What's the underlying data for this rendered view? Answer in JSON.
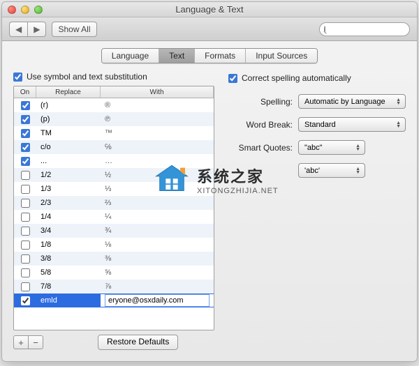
{
  "window_title": "Language & Text",
  "toolbar": {
    "show_all": "Show All",
    "search_placeholder": ""
  },
  "tabs": [
    "Language",
    "Text",
    "Formats",
    "Input Sources"
  ],
  "active_tab": "Text",
  "left": {
    "checkbox_label": "Use symbol and text substitution",
    "checkbox_checked": true,
    "headers": {
      "on": "On",
      "replace": "Replace",
      "with": "With"
    },
    "rows": [
      {
        "on": true,
        "replace": "(r)",
        "with": "®"
      },
      {
        "on": true,
        "replace": "(p)",
        "with": "℗"
      },
      {
        "on": true,
        "replace": "TM",
        "with": "™"
      },
      {
        "on": true,
        "replace": "c/o",
        "with": "℅"
      },
      {
        "on": true,
        "replace": "...",
        "with": "…"
      },
      {
        "on": false,
        "replace": "1/2",
        "with": "½"
      },
      {
        "on": false,
        "replace": "1/3",
        "with": "⅓"
      },
      {
        "on": false,
        "replace": "2/3",
        "with": "⅔"
      },
      {
        "on": false,
        "replace": "1/4",
        "with": "¼"
      },
      {
        "on": false,
        "replace": "3/4",
        "with": "¾"
      },
      {
        "on": false,
        "replace": "1/8",
        "with": "⅛"
      },
      {
        "on": false,
        "replace": "3/8",
        "with": "⅜"
      },
      {
        "on": false,
        "replace": "5/8",
        "with": "⅝"
      },
      {
        "on": false,
        "replace": "7/8",
        "with": "⅞"
      },
      {
        "on": true,
        "replace": "emld",
        "with": "eryone@osxdaily.com",
        "selected": true,
        "editing": true
      }
    ],
    "restore_label": "Restore Defaults"
  },
  "right": {
    "correct_label": "Correct spelling automatically",
    "correct_checked": true,
    "spelling_label": "Spelling:",
    "spelling_value": "Automatic by Language",
    "wordbreak_label": "Word Break:",
    "wordbreak_value": "Standard",
    "smartquotes_label": "Smart Quotes:",
    "smartquotes_double": "\"abc\"",
    "smartquotes_single": "'abc'"
  },
  "watermark": {
    "cn": "系统之家",
    "url": "XITONGZHIJIA.NET"
  }
}
